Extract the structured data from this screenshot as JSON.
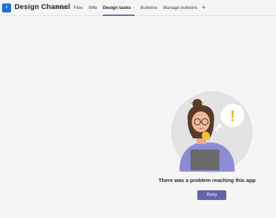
{
  "header": {
    "channel_avatar": "≡",
    "channel_name": "Design Channel",
    "tabs": [
      {
        "label": "Posts"
      },
      {
        "label": "Files"
      },
      {
        "label": "Wiki"
      },
      {
        "label": "Design tasks",
        "active": true
      },
      {
        "label": "Bulletins"
      },
      {
        "label": "Manage bulletins"
      }
    ],
    "add_tab_icon": "+"
  },
  "illustration": {
    "thought_icon": "!"
  },
  "message": {
    "error_text": "There was a problem reaching this app",
    "retry_label": "Retry"
  },
  "colors": {
    "accent": "#6264a7",
    "avatar": "#1f6fd8",
    "background": "#f5f5f5",
    "warning": "#f2b600"
  }
}
